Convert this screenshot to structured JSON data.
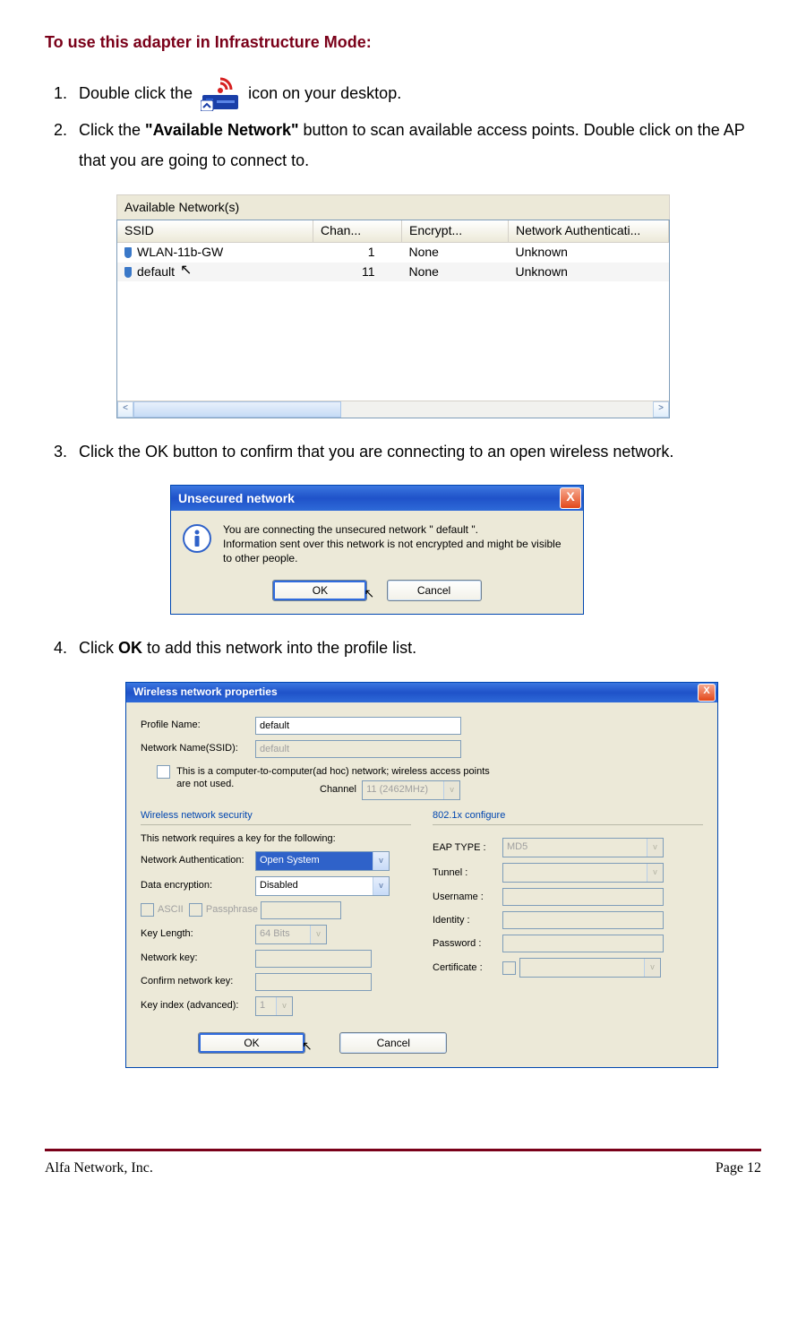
{
  "heading": "To use this adapter in Infrastructure Mode:",
  "steps": {
    "s1a": "Double click the ",
    "s1b": " icon on your desktop.",
    "s2a": "Click the ",
    "s2b": "\"Available Network\"",
    "s2c": " button to scan available access points. Double click on the AP that you are going to connect to.",
    "s3": "Click the OK button to confirm that you are connecting to an open wireless network.",
    "s4a": "Click ",
    "s4b": "OK",
    "s4c": " to add this network into the profile list."
  },
  "shotA": {
    "title": "Available Network(s)",
    "cols": {
      "ssid": "SSID",
      "chan": "Chan...",
      "enc": "Encrypt...",
      "auth": "Network Authenticati..."
    },
    "rows": [
      {
        "ssid": "WLAN-11b-GW",
        "chan": "1",
        "enc": "None",
        "auth": "Unknown"
      },
      {
        "ssid": "default",
        "chan": "11",
        "enc": "None",
        "auth": "Unknown"
      }
    ],
    "arrow_left": "<",
    "arrow_right": ">"
  },
  "shotB": {
    "title": "Unsecured network",
    "msg1": "You are connecting the unsecured network \" default \".",
    "msg2": "Information sent over this network is not encrypted and might be visible to other people.",
    "ok": "OK",
    "cancel": "Cancel",
    "close": "X"
  },
  "shotC": {
    "title": "Wireless network properties",
    "lbl_profile": "Profile Name:",
    "val_profile": "default",
    "lbl_ssid": "Network Name(SSID):",
    "val_ssid": "default",
    "adhoc": "This is a computer-to-computer(ad hoc) network; wireless access points are not used.",
    "lbl_channel": "Channel",
    "val_channel": "11 (2462MHz)",
    "grp_sec": "Wireless network security",
    "sec_desc": "This network requires a key for the following:",
    "lbl_auth": "Network Authentication:",
    "val_auth": "Open System",
    "lbl_enc": "Data encryption:",
    "val_enc": "Disabled",
    "chk_ascii": "ASCII",
    "chk_pass": "Passphrase",
    "lbl_keylen": "Key Length:",
    "val_keylen": "64 Bits",
    "lbl_netkey": "Network key:",
    "lbl_cnetkey": "Confirm network key:",
    "lbl_keyidx": "Key index (advanced):",
    "val_keyidx": "1",
    "grp_8021x": "802.1x configure",
    "lbl_eap": "EAP TYPE :",
    "val_eap": "MD5",
    "lbl_tunnel": "Tunnel :",
    "lbl_user": "Username :",
    "lbl_identity": "Identity :",
    "lbl_pwd": "Password :",
    "lbl_cert": "Certificate :",
    "ok": "OK",
    "cancel": "Cancel",
    "close": "X"
  },
  "footer": {
    "left": "Alfa Network, Inc.",
    "right": "Page 12"
  }
}
